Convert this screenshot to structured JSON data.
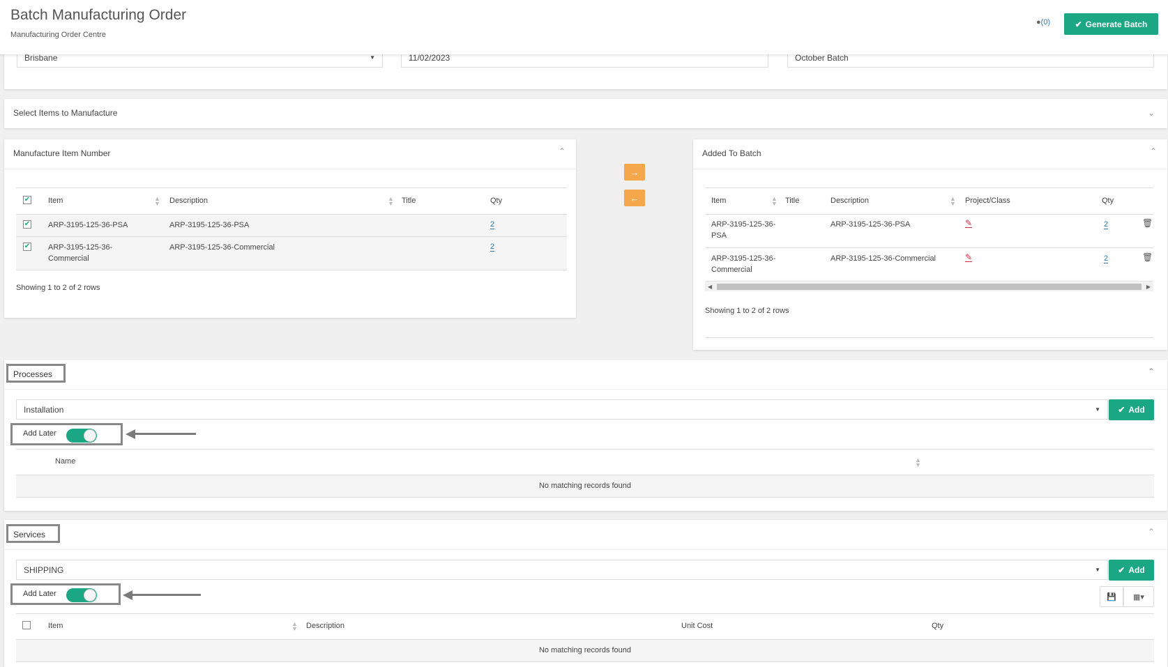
{
  "header": {
    "title": "Batch Manufacturing Order",
    "subtitle": "Manufacturing Order Centre",
    "comments": "(0)",
    "generate_label": "Generate Batch"
  },
  "top_fields": {
    "location": "Brisbane",
    "date": "11/02/2023",
    "batch_name": "October Batch"
  },
  "select_items": {
    "title": "Select Items to Manufacture"
  },
  "manufacture_panel": {
    "title": "Manufacture Item Number",
    "columns": [
      "Item",
      "Description",
      "Title",
      "Qty"
    ],
    "rows": [
      {
        "item": "ARP-3195-125-36-PSA",
        "description": "ARP-3195-125-36-PSA",
        "title": "",
        "qty": "2"
      },
      {
        "item": "ARP-3195-125-36-Commercial",
        "description": "ARP-3195-125-36-Commercial",
        "title": "",
        "qty": "2"
      }
    ],
    "footer": "Showing 1 to 2 of 2 rows"
  },
  "batch_panel": {
    "title": "Added To Batch",
    "columns": [
      "Item",
      "Title",
      "Description",
      "Project/Class",
      "Qty"
    ],
    "rows": [
      {
        "item": "ARP-3195-125-36-PSA",
        "title": "",
        "description": "ARP-3195-125-36-PSA",
        "qty": "2"
      },
      {
        "item": "ARP-3195-125-36-Commercial",
        "title": "",
        "description": "ARP-3195-125-36-Commercial",
        "qty": "2"
      }
    ],
    "footer": "Showing 1 to 2 of 2 rows"
  },
  "processes": {
    "title": "Processes",
    "select_value": "Installation",
    "add_label": "Add",
    "add_later_label": "Add Later",
    "add_later_on": true,
    "column_name": "Name",
    "empty": "No matching records found"
  },
  "services": {
    "title": "Services",
    "select_value": "SHIPPING",
    "add_label": "Add",
    "add_later_label": "Add Later",
    "add_later_on": true,
    "columns": [
      "Item",
      "Description",
      "Unit Cost",
      "Qty"
    ],
    "empty": "No matching records found"
  },
  "colors": {
    "accent_green": "#1ba784",
    "orange": "#f5a74b",
    "link_blue": "#2a7ab8"
  },
  "icons": [
    "check-icon",
    "comment-icon",
    "arrow-right-icon",
    "arrow-left-icon",
    "chevron-up-icon",
    "chevron-down-icon",
    "pencil-icon",
    "trash-icon",
    "save-icon",
    "columns-icon",
    "sort-icon"
  ]
}
